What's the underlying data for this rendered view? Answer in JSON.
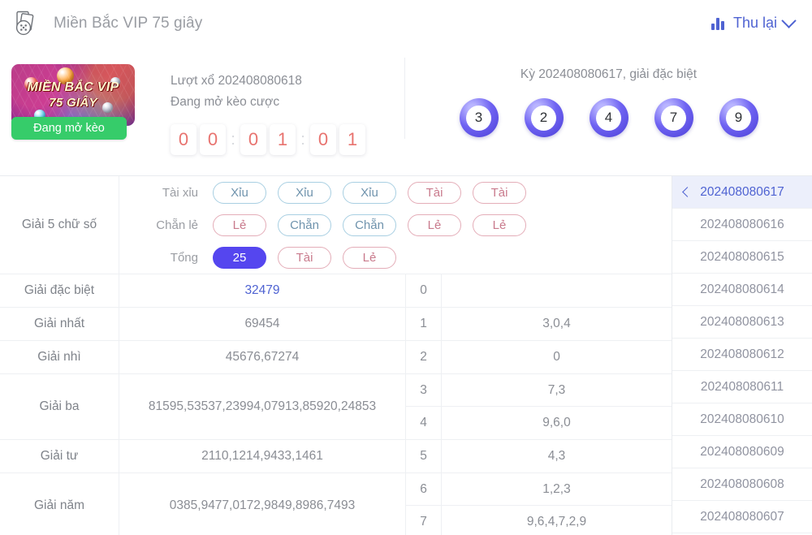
{
  "header": {
    "icon": "cards-dice-icon",
    "title": "Miền Bắc VIP 75 giây",
    "collapse_label": "Thu lại",
    "collapse_icon": "bar-chart-icon",
    "chevron_icon": "chevron-down-icon"
  },
  "logo": {
    "line1": "MIỀN BẮC VIP",
    "line2": "75 GIÂY",
    "status_badge": "Đang mở kèo"
  },
  "draw": {
    "draw_line": "Lượt xổ 202408080618",
    "status_line": "Đang mở kèo cược",
    "countdown": [
      "0",
      "0",
      "0",
      "1",
      "0",
      "1"
    ],
    "separator": ":"
  },
  "result": {
    "title": "Kỳ 202408080617, giải đặc biệt",
    "balls": [
      "3",
      "2",
      "4",
      "7",
      "9"
    ]
  },
  "bets": {
    "section_label": "Giải 5 chữ số",
    "rows": [
      {
        "label": "Tài xỉu",
        "tags": [
          {
            "text": "Xỉu",
            "style": "blue"
          },
          {
            "text": "Xỉu",
            "style": "blue"
          },
          {
            "text": "Xỉu",
            "style": "blue"
          },
          {
            "text": "Tài",
            "style": "red"
          },
          {
            "text": "Tài",
            "style": "red"
          }
        ]
      },
      {
        "label": "Chẵn lẻ",
        "tags": [
          {
            "text": "Lẻ",
            "style": "red"
          },
          {
            "text": "Chẵn",
            "style": "blue"
          },
          {
            "text": "Chẵn",
            "style": "blue"
          },
          {
            "text": "Lẻ",
            "style": "red"
          },
          {
            "text": "Lẻ",
            "style": "red"
          }
        ]
      },
      {
        "label": "Tổng",
        "tags": [
          {
            "text": "25",
            "style": "solid"
          },
          {
            "text": "Tài",
            "style": "red"
          },
          {
            "text": "Lẻ",
            "style": "red"
          }
        ]
      }
    ]
  },
  "prizes": [
    {
      "label": "Giải đặc biệt",
      "value": "32479",
      "highlight": true
    },
    {
      "label": "Giải nhất",
      "value": "69454",
      "highlight": false
    },
    {
      "label": "Giải nhì",
      "value": "45676,67274",
      "highlight": false
    },
    {
      "label": "Giải ba",
      "value": "81595,53537,23994,07913,85920,24853",
      "highlight": false
    },
    {
      "label": "Giải tư",
      "value": "2110,1214,9433,1461",
      "highlight": false
    },
    {
      "label": "Giải năm",
      "value": "0385,9477,0172,9849,8986,7493",
      "highlight": false
    }
  ],
  "tails": [
    {
      "digit": "0",
      "values": ""
    },
    {
      "digit": "1",
      "values": "3,0,4"
    },
    {
      "digit": "2",
      "values": "0"
    },
    {
      "digit": "3",
      "values": "7,3"
    },
    {
      "digit": "4",
      "values": "9,6,0"
    },
    {
      "digit": "5",
      "values": "4,3"
    },
    {
      "digit": "6",
      "values": "1,2,3"
    },
    {
      "digit": "7",
      "values": "9,6,4,7,2,9"
    }
  ],
  "periods": [
    {
      "id": "202408080617",
      "selected": true
    },
    {
      "id": "202408080616",
      "selected": false
    },
    {
      "id": "202408080615",
      "selected": false
    },
    {
      "id": "202408080614",
      "selected": false
    },
    {
      "id": "202408080613",
      "selected": false
    },
    {
      "id": "202408080612",
      "selected": false
    },
    {
      "id": "202408080611",
      "selected": false
    },
    {
      "id": "202408080610",
      "selected": false
    },
    {
      "id": "202408080609",
      "selected": false
    },
    {
      "id": "202408080608",
      "selected": false
    },
    {
      "id": "202408080607",
      "selected": false
    }
  ],
  "colors": {
    "accent": "#4f63d2",
    "solid_tag": "#5546ef",
    "badge_green": "#36cc6a",
    "countdown_red": "#e8736f",
    "tag_blue": "#a8cfe2",
    "tag_red": "#e4adb8"
  }
}
